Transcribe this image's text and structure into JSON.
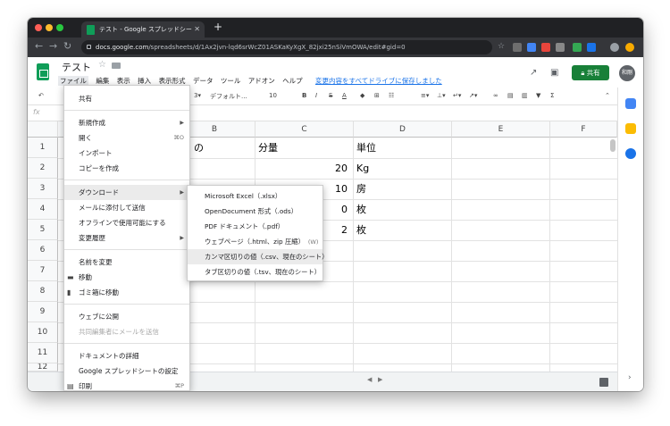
{
  "tab": {
    "title": "テスト - Google スプレッドシー",
    "close": "✕",
    "new": "+"
  },
  "address": {
    "host": "docs.google.com",
    "path": "/spreadsheets/d/1Ax2jvn-lqd6srWcZ01ASKaKyXgX_82jxi25nSiVmOWA/edit#gid=0"
  },
  "doc": {
    "title": "テスト"
  },
  "menus": [
    "ファイル",
    "編集",
    "表示",
    "挿入",
    "表示形式",
    "データ",
    "ツール",
    "アドオン",
    "ヘルプ"
  ],
  "save_link": "変更内容をすべてドライブに保存しました",
  "share_label": "共有",
  "avatar": "和剛",
  "toolbar": {
    "font": "デフォルト...",
    "size": "10",
    "bold": "B",
    "italic": "I",
    "strike": "S",
    "text_color": "A",
    "functions": "Σ"
  },
  "fx_label": "fx",
  "columns": [
    "B",
    "C",
    "D",
    "E",
    "F"
  ],
  "rows": [
    "1",
    "2",
    "3",
    "4",
    "5",
    "6",
    "7",
    "8",
    "9",
    "10",
    "11",
    "12"
  ],
  "cells": {
    "b1": "の",
    "c1": "分量",
    "d1": "単位",
    "c2": "20",
    "d2": "Kg",
    "c3": "10",
    "d3": "房",
    "c4": "0",
    "d4": "枚",
    "c5": "2",
    "d5": "枚",
    "b3": "1"
  },
  "file_menu": [
    {
      "label": "共有"
    },
    {
      "label": "新規作成",
      "arrow": "▶"
    },
    {
      "label": "開く",
      "shortcut": "⌘O"
    },
    {
      "label": "インポート"
    },
    {
      "label": "コピーを作成"
    },
    {
      "label": "ダウンロード",
      "arrow": "▶"
    },
    {
      "label": "メールに添付して送信"
    },
    {
      "label": "オフラインで使用可能にする"
    },
    {
      "label": "変更履歴",
      "arrow": "▶"
    },
    {
      "label": "名前を変更"
    },
    {
      "label": "移動"
    },
    {
      "label": "ゴミ箱に移動"
    },
    {
      "label": "ウェブに公開"
    },
    {
      "label": "共同編集者にメールを送信"
    },
    {
      "label": "ドキュメントの詳細"
    },
    {
      "label": "Google スプレッドシートの設定"
    },
    {
      "label": "印刷",
      "shortcut": "⌘P"
    }
  ],
  "download_menu": [
    {
      "label": "Microsoft Excel（.xlsx）"
    },
    {
      "label": "OpenDocument 形式（.ods）"
    },
    {
      "label": "PDF ドキュメント（.pdf）"
    },
    {
      "label": "ウェブページ（.html、zip 圧縮）",
      "shortcut": "(W)"
    },
    {
      "label": "カンマ区切りの値（.csv、現在のシート）"
    },
    {
      "label": "タブ区切りの値（.tsv、現在のシート）"
    }
  ],
  "colors": {
    "accent": "#188038",
    "link": "#1a73e8",
    "chrome_dark": "#202124"
  }
}
